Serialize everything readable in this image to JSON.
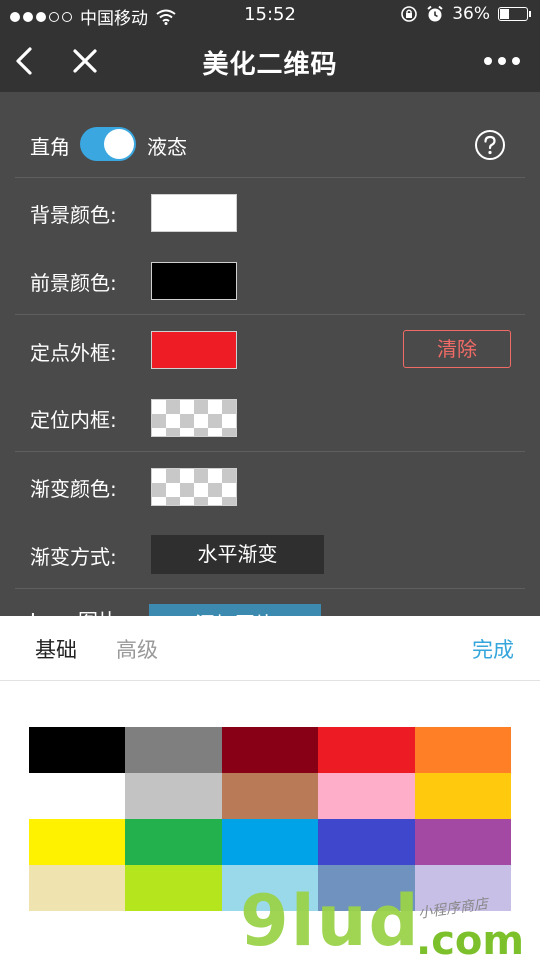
{
  "status_bar": {
    "carrier": "中国移动",
    "time": "15:52",
    "battery": "36%",
    "battery_level": 0.36
  },
  "nav": {
    "title": "美化二维码"
  },
  "panel": {
    "toggle_left": "直角",
    "toggle_right": "液态",
    "toggle_on": true,
    "background_label": "背景颜色:",
    "background_color": "#ffffff",
    "foreground_label": "前景颜色:",
    "foreground_color": "#000000",
    "anchor_outer_label": "定点外框:",
    "anchor_outer_color": "#ee1c25",
    "clear_button": "清除",
    "anchor_inner_label": "定位内框:",
    "gradient_color_label": "渐变颜色:",
    "gradient_mode_label": "渐变方式:",
    "gradient_mode_value": "水平渐变",
    "partial_label": "Logo图片:",
    "add_button": "添加图片"
  },
  "sheet": {
    "tab_basic": "基础",
    "tab_advanced": "高级",
    "done": "完成",
    "palette": [
      "#000000",
      "#7f7f7f",
      "#880015",
      "#ed1c24",
      "#ff7f27",
      "#ffffff",
      "#c3c3c3",
      "#b97a57",
      "#ffaec9",
      "#ffc90e",
      "#fff200",
      "#22b14c",
      "#00a2e8",
      "#3f48cc",
      "#a349a4",
      "#efe4b0",
      "#b5e61d",
      "#99d9ea",
      "#7092be",
      "#c8bfe7"
    ]
  },
  "watermark": {
    "brand": "9lud",
    "domain_suffix": ".com",
    "caption": "小程序商店"
  }
}
